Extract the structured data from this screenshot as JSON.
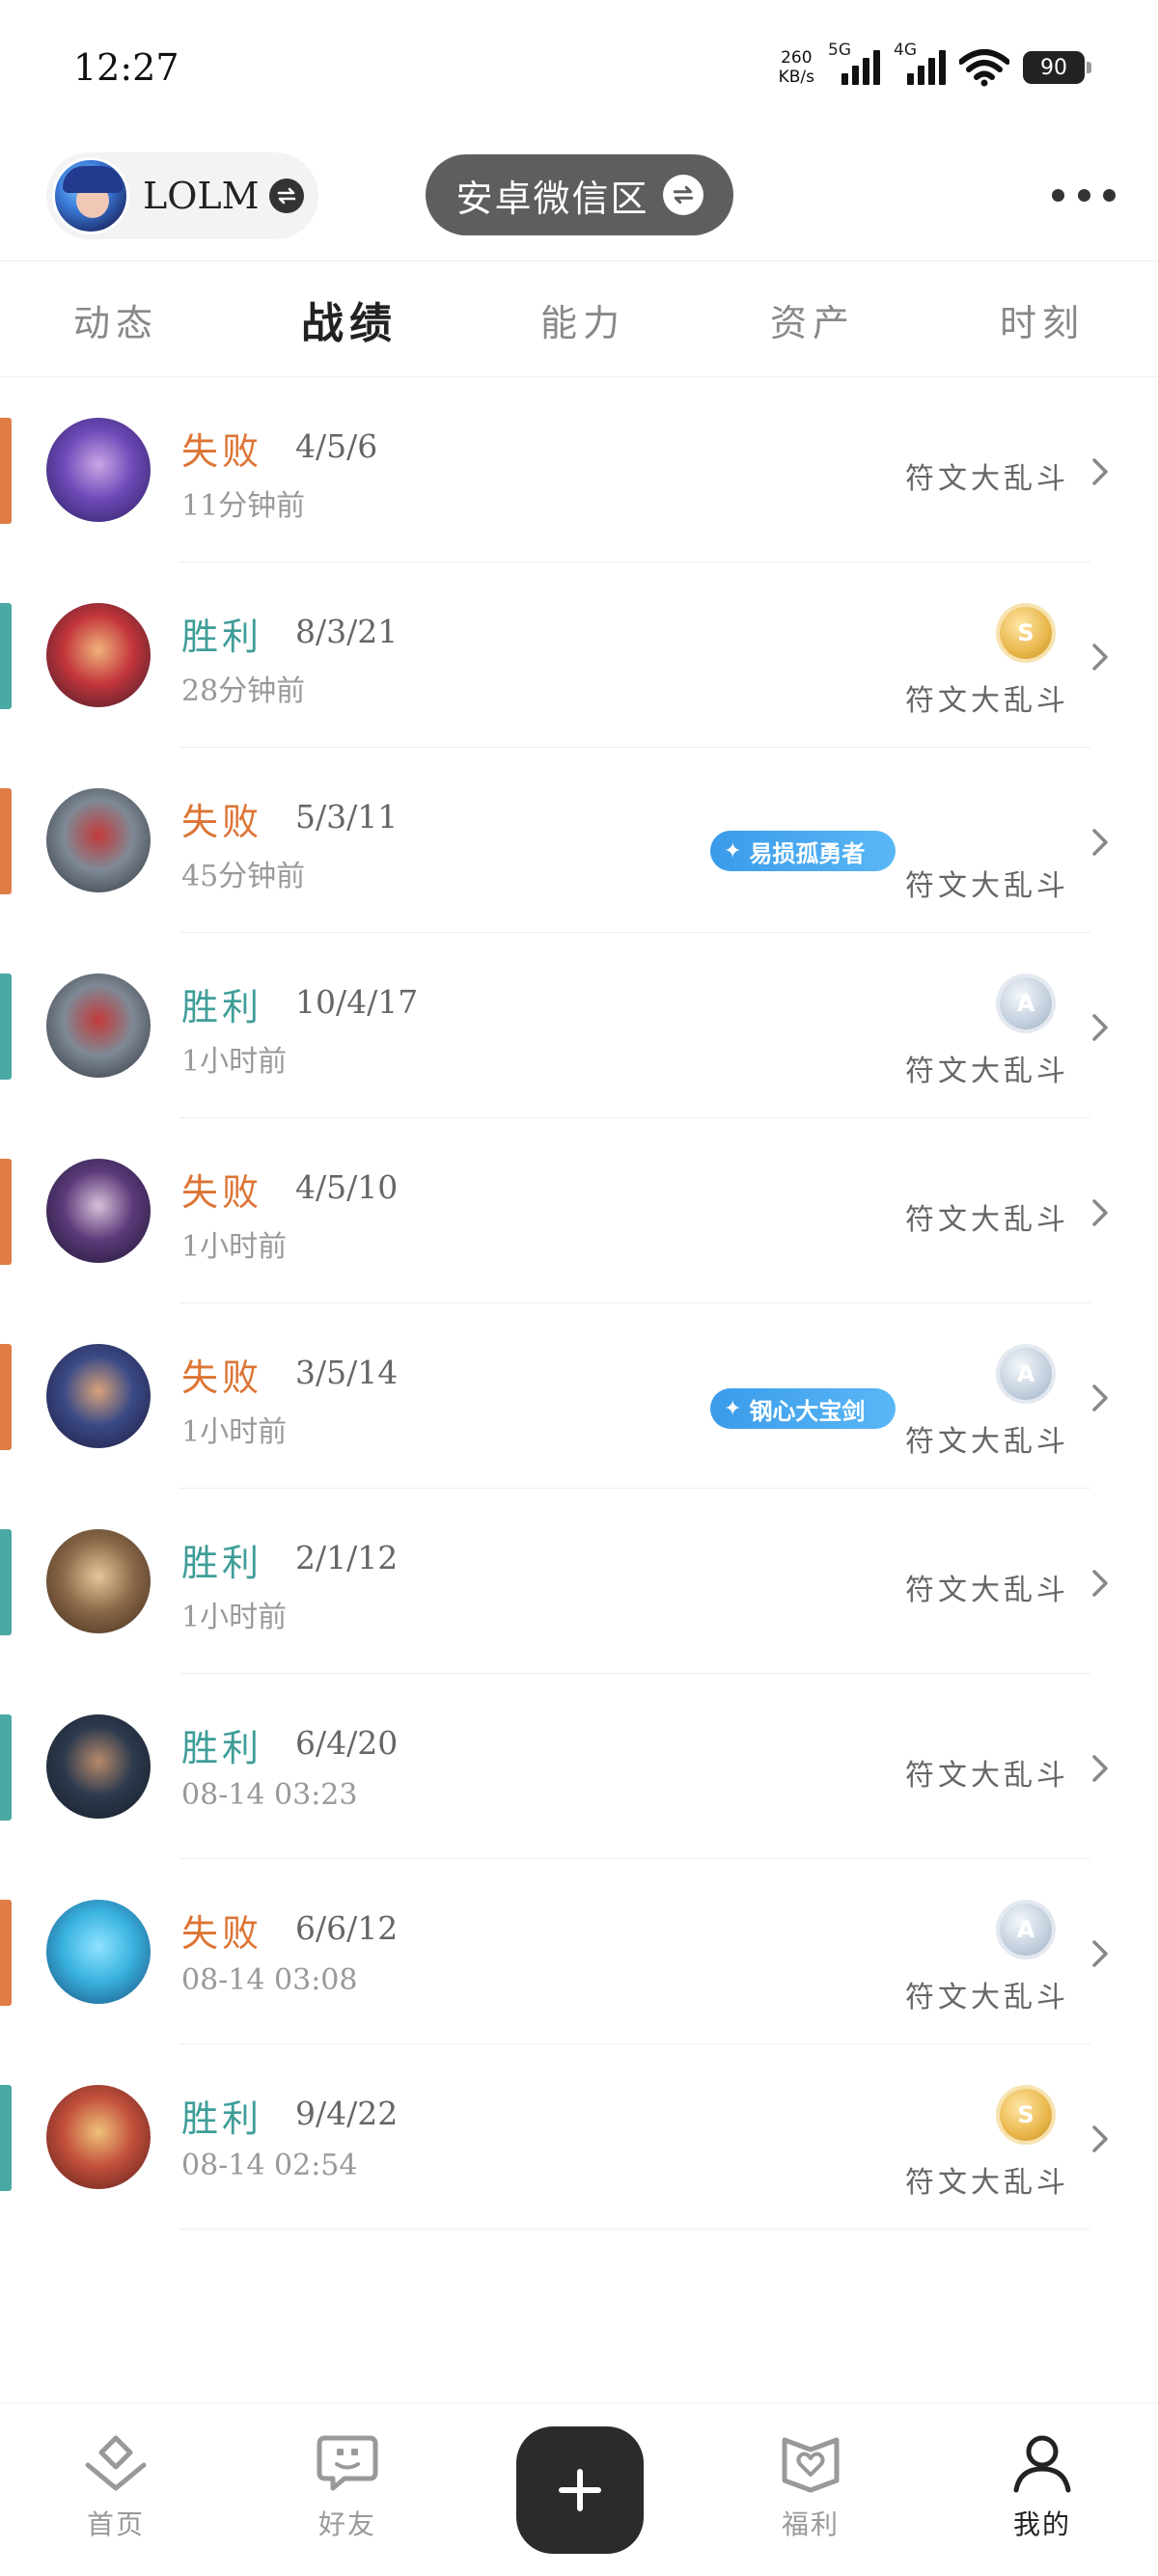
{
  "status_bar": {
    "time": "12:27",
    "net_speed_value": "260",
    "net_speed_unit": "KB/s",
    "signal1_label": "5G",
    "signal2_label": "4G",
    "battery": "90"
  },
  "header": {
    "account_name": "LOLM",
    "server_name": "安卓微信区"
  },
  "tabs": [
    {
      "label": "动态",
      "active": false
    },
    {
      "label": "战绩",
      "active": true
    },
    {
      "label": "能力",
      "active": false
    },
    {
      "label": "资产",
      "active": false
    },
    {
      "label": "时刻",
      "active": false
    }
  ],
  "matches": [
    {
      "result": "失败",
      "outcome": "loss",
      "kda": "4/5/6",
      "time": "11分钟前",
      "mode": "符文大乱斗",
      "medal": null,
      "badge": null
    },
    {
      "result": "胜利",
      "outcome": "win",
      "kda": "8/3/21",
      "time": "28分钟前",
      "mode": "符文大乱斗",
      "medal": "S",
      "badge": null
    },
    {
      "result": "失败",
      "outcome": "loss",
      "kda": "5/3/11",
      "time": "45分钟前",
      "mode": "符文大乱斗",
      "medal": null,
      "badge": "易损孤勇者"
    },
    {
      "result": "胜利",
      "outcome": "win",
      "kda": "10/4/17",
      "time": "1小时前",
      "mode": "符文大乱斗",
      "medal": "A",
      "badge": null
    },
    {
      "result": "失败",
      "outcome": "loss",
      "kda": "4/5/10",
      "time": "1小时前",
      "mode": "符文大乱斗",
      "medal": null,
      "badge": null
    },
    {
      "result": "失败",
      "outcome": "loss",
      "kda": "3/5/14",
      "time": "1小时前",
      "mode": "符文大乱斗",
      "medal": "A",
      "badge": "钢心大宝剑"
    },
    {
      "result": "胜利",
      "outcome": "win",
      "kda": "2/1/12",
      "time": "1小时前",
      "mode": "符文大乱斗",
      "medal": null,
      "badge": null
    },
    {
      "result": "胜利",
      "outcome": "win",
      "kda": "6/4/20",
      "time": "08-14  03:23",
      "mode": "符文大乱斗",
      "medal": null,
      "badge": null
    },
    {
      "result": "失败",
      "outcome": "loss",
      "kda": "6/6/12",
      "time": "08-14  03:08",
      "mode": "符文大乱斗",
      "medal": "A",
      "badge": null
    },
    {
      "result": "胜利",
      "outcome": "win",
      "kda": "9/4/22",
      "time": "08-14  02:54",
      "mode": "符文大乱斗",
      "medal": "S",
      "badge": null
    }
  ],
  "bottom_nav": {
    "home": "首页",
    "friends": "好友",
    "benefits": "福利",
    "me": "我的"
  },
  "colors": {
    "win": "#3f9d98",
    "loss": "#dd7434",
    "accent_win": "#4aa9a4",
    "accent_loss": "#e07c45",
    "badge": "#3a9bea"
  }
}
